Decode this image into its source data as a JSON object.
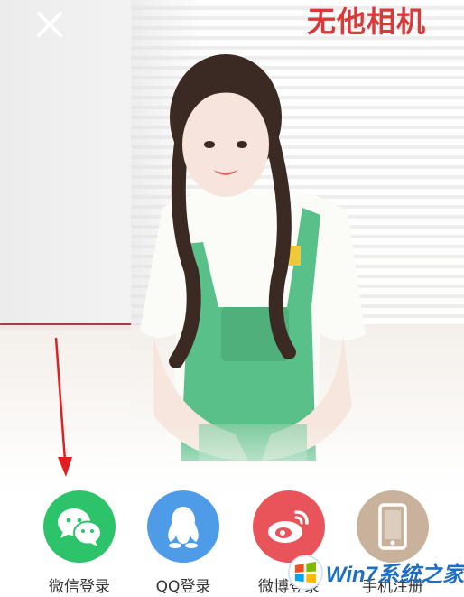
{
  "header": {
    "close_icon": "close-icon",
    "app_title": "无他相机"
  },
  "login_options": [
    {
      "label": "微信登录",
      "icon": "wechat-icon",
      "color": "#2dc36a"
    },
    {
      "label": "QQ登录",
      "icon": "qq-penguin-icon",
      "color": "#4e9ce8"
    },
    {
      "label": "微博登录",
      "icon": "weibo-icon",
      "color": "#e8545a"
    },
    {
      "label": "手机注册",
      "icon": "phone-icon",
      "color": "#c9b29c"
    }
  ],
  "watermark": {
    "text": "Win7系统之家"
  },
  "colors": {
    "accent_red": "#d83a3a",
    "arrow": "#e02020"
  }
}
